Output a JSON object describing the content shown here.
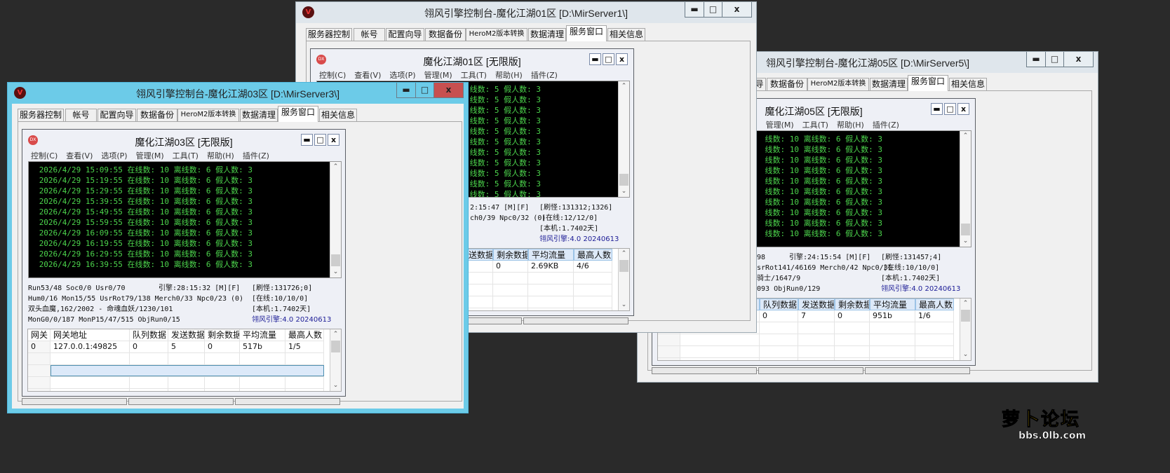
{
  "logo": {
    "title": "萝卜论坛",
    "url": "bbs.0lb.com"
  },
  "tabs": [
    "服务器控制",
    "帐号",
    "配置向导",
    "数据备份",
    "HeroM2版本转换",
    "数据清理",
    "服务窗口",
    "相关信息"
  ],
  "selected_tab": "服务窗口",
  "menu": [
    "控制(C)",
    "查看(V)",
    "选项(P)",
    "管理(M)",
    "工具(T)",
    "帮助(H)",
    "插件(Z)"
  ],
  "window_buttons": {
    "minimize": "▬",
    "maximize": "□",
    "close": "x"
  },
  "colors": {
    "active_title": "#6ccbe8",
    "log_text": "#4cd44c",
    "log_bg": "#000000",
    "close_active": "#c75050",
    "version_text": "#1c1c96"
  },
  "windows": [
    {
      "id": "w5",
      "title": "翎风引擎控制台-魔化江湖05区 [D:\\MirServer5\\]",
      "mdi_title": "魔化江湖05区 [无限版]",
      "active": false,
      "log": [
        "线数: 10 离线数: 6 假人数: 3",
        "线数: 10 离线数: 6 假人数: 3",
        "线数: 10 离线数: 6 假人数: 3",
        "线数: 10 离线数: 6 假人数: 3",
        "线数: 10 离线数: 6 假人数: 3",
        "线数: 10 离线数: 6 假人数: 3",
        "线数: 10 离线数: 6 假人数: 3",
        "线数: 10 离线数: 6 假人数: 3",
        "线数: 10 离线数: 6 假人数: 3",
        "线数: 10 离线数: 6 假人数: 3"
      ],
      "status": [
        [
          "98",
          "引擎:24:15:54 [M][F]",
          "[刷怪:131457;4]"
        ],
        [
          "srRot141/46169 Merch0/42 Npc0/31",
          "[在线:10/10/0]"
        ],
        [
          "骑士/1647/9",
          "[本机:1.7402天]"
        ],
        [
          "093 ObjRun0/129",
          "翎风引擎:4.0 20240613"
        ]
      ],
      "grid_headers": [
        null,
        null,
        "队列数据",
        "发送数据",
        "剩余数据",
        "平均流量",
        "最高人数"
      ],
      "grid_rows": [
        [
          null,
          null,
          "0",
          "7",
          "0",
          "951b",
          "1/6"
        ]
      ]
    },
    {
      "id": "w1",
      "title": "翎风引擎控制台-魔化江湖01区 [D:\\MirServer1\\]",
      "mdi_title": "魔化江湖01区 [无限版]",
      "active": false,
      "log": [
        "线数: 5 假人数: 3",
        "线数: 5 假人数: 3",
        "线数: 5 假人数: 3",
        "线数: 5 假人数: 3",
        "线数: 5 假人数: 3",
        "线数: 5 假人数: 3",
        "线数: 5 假人数: 3",
        "线数: 5 假人数: 3",
        "线数: 5 假人数: 3",
        "线数: 5 假人数: 3",
        "线数: 5 假人数: 3"
      ],
      "status": [
        [
          "2:15:47 [M][F]",
          "[刷怪:131312;1326]"
        ],
        [
          "ch0/39 Npc0/32 (0)",
          "[在线:12/12/0]"
        ],
        [
          "[本机:1.7402天]"
        ],
        [
          "翎风引擎:4.0 20240613"
        ]
      ],
      "grid_headers": [
        null,
        null,
        null,
        "发送数据",
        "剩余数据",
        "平均流量",
        "最高人数"
      ],
      "grid_rows": [
        [
          null,
          null,
          null,
          null,
          "0",
          "2.69KB",
          "4/6"
        ]
      ]
    },
    {
      "id": "w3",
      "title": "翎风引擎控制台-魔化江湖03区 [D:\\MirServer3\\]",
      "mdi_title": "魔化江湖03区 [无限版]",
      "active": true,
      "log": [
        "2026/4/29 15:09:55 在线数: 10 离线数: 6 假人数: 3",
        "2026/4/29 15:19:55 在线数: 10 离线数: 6 假人数: 3",
        "2026/4/29 15:29:55 在线数: 10 离线数: 6 假人数: 3",
        "2026/4/29 15:39:55 在线数: 10 离线数: 6 假人数: 3",
        "2026/4/29 15:49:55 在线数: 10 离线数: 6 假人数: 3",
        "2026/4/29 15:59:55 在线数: 10 离线数: 6 假人数: 3",
        "2026/4/29 16:09:55 在线数: 10 离线数: 6 假人数: 3",
        "2026/4/29 16:19:55 在线数: 10 离线数: 6 假人数: 3",
        "2026/4/29 16:29:55 在线数: 10 离线数: 6 假人数: 3",
        "2026/4/29 16:39:55 在线数: 10 离线数: 6 假人数: 3"
      ],
      "status": [
        [
          "Run53/48 Soc0/0 Usr0/70",
          "引擎:28:15:32 [M][F]",
          "[刷怪:131726;0]"
        ],
        [
          "Hum0/16 Mon15/55 UsrRot79/138 Merch0/33 Npc0/23 (0)",
          "[在线:10/10/0]"
        ],
        [
          "双头血魔,162/2002 - 命魂血妖/1230/101",
          "[本机:1.7402天]"
        ],
        [
          "MonG0/0/187 MonP15/47/515 ObjRun0/15",
          "翎风引擎:4.0 20240613"
        ]
      ],
      "grid_headers": [
        "网关",
        "网关地址",
        "队列数据",
        "发送数据",
        "剩余数据",
        "平均流量",
        "最高人数"
      ],
      "grid_rows": [
        [
          "0",
          "127.0.0.1:49825",
          "0",
          "5",
          "0",
          "517b",
          "1/5"
        ]
      ]
    }
  ]
}
